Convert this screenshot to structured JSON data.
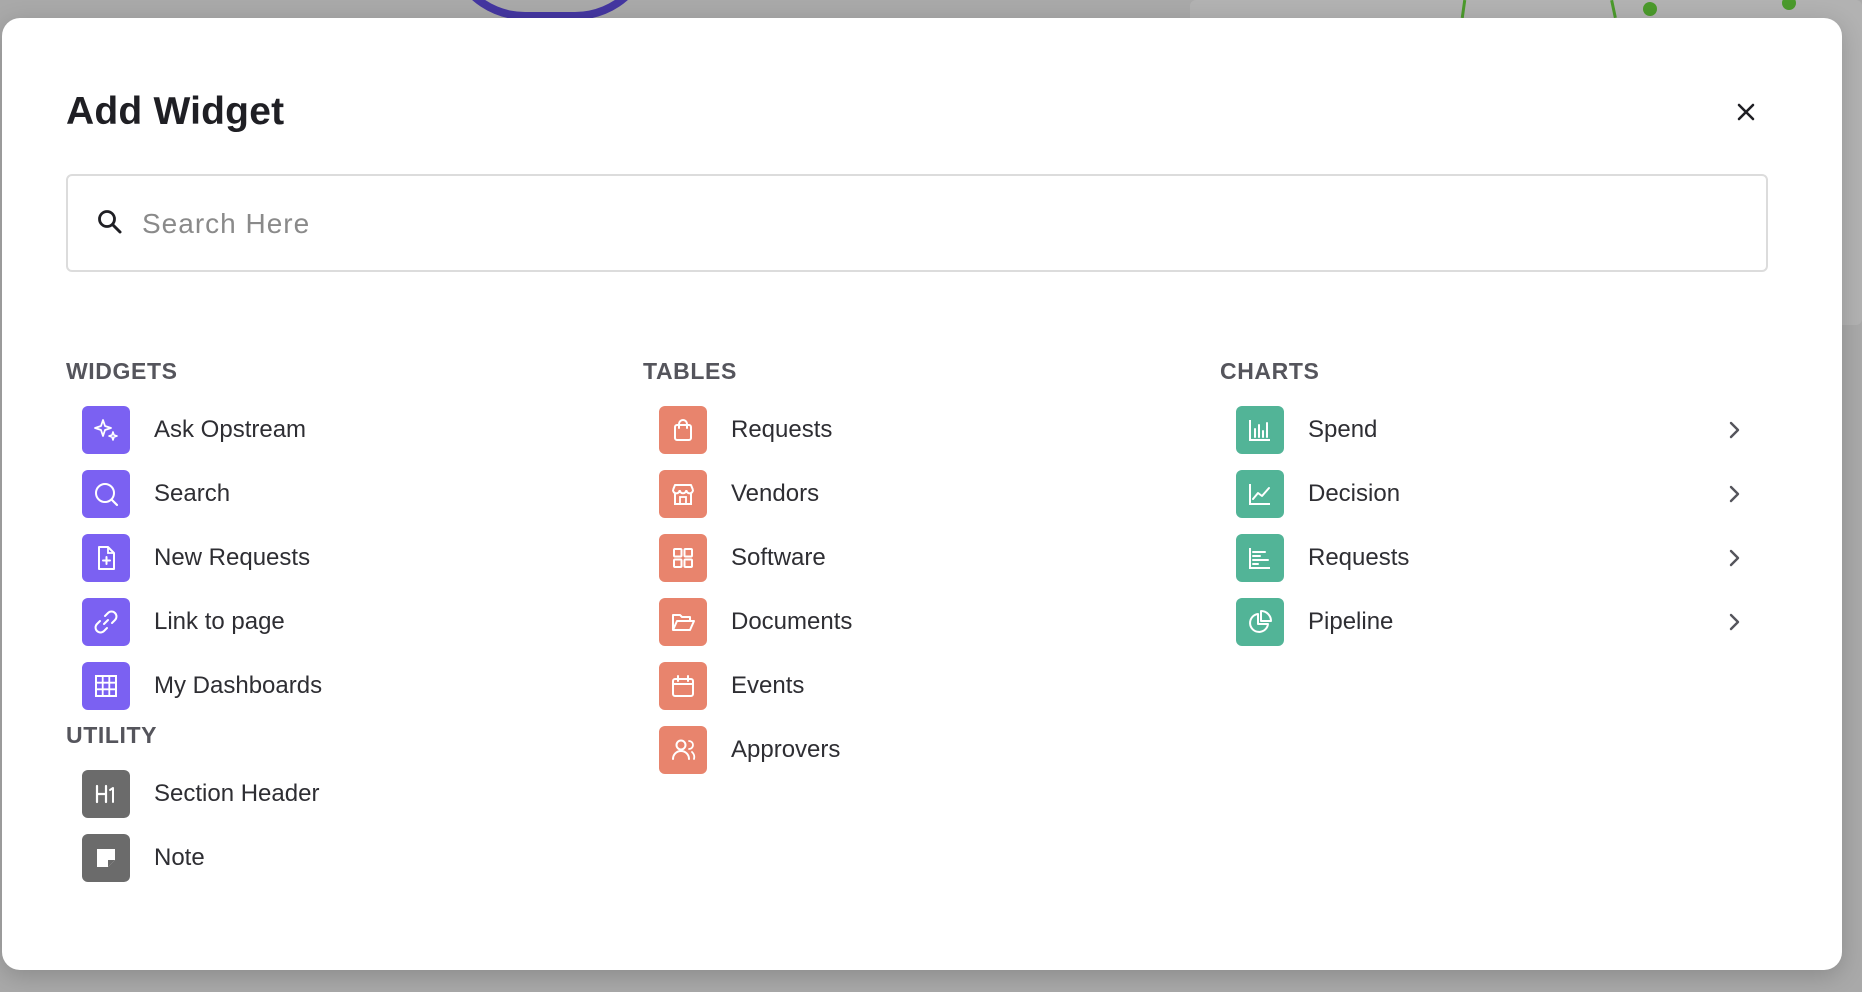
{
  "modal": {
    "title": "Add Widget",
    "search_placeholder": "Search Here"
  },
  "colors": {
    "widgets": "#7b61f2",
    "tables": "#e8846d",
    "charts": "#52b497",
    "utility": "#6b6b6b"
  },
  "widgets": {
    "title": "WIDGETS",
    "items": [
      {
        "label": "Ask Opstream",
        "icon": "sparkle-icon"
      },
      {
        "label": "Search",
        "icon": "search-icon"
      },
      {
        "label": "New Requests",
        "icon": "file-plus-icon"
      },
      {
        "label": "Link to page",
        "icon": "link-icon"
      },
      {
        "label": "My Dashboards",
        "icon": "grid-icon"
      }
    ]
  },
  "utility": {
    "title": "UTILITY",
    "items": [
      {
        "label": "Section Header",
        "icon": "heading-icon"
      },
      {
        "label": "Note",
        "icon": "note-icon"
      }
    ]
  },
  "tables": {
    "title": "TABLES",
    "items": [
      {
        "label": "Requests",
        "icon": "shopping-bag-icon"
      },
      {
        "label": "Vendors",
        "icon": "store-icon"
      },
      {
        "label": "Software",
        "icon": "apps-icon"
      },
      {
        "label": "Documents",
        "icon": "folder-open-icon"
      },
      {
        "label": "Events",
        "icon": "calendar-icon"
      },
      {
        "label": "Approvers",
        "icon": "users-icon"
      }
    ]
  },
  "charts": {
    "title": "CHARTS",
    "items": [
      {
        "label": "Spend",
        "icon": "bar-chart-icon"
      },
      {
        "label": "Decision",
        "icon": "line-chart-icon"
      },
      {
        "label": "Requests",
        "icon": "horizontal-bar-chart-icon"
      },
      {
        "label": "Pipeline",
        "icon": "pie-chart-icon"
      }
    ]
  }
}
